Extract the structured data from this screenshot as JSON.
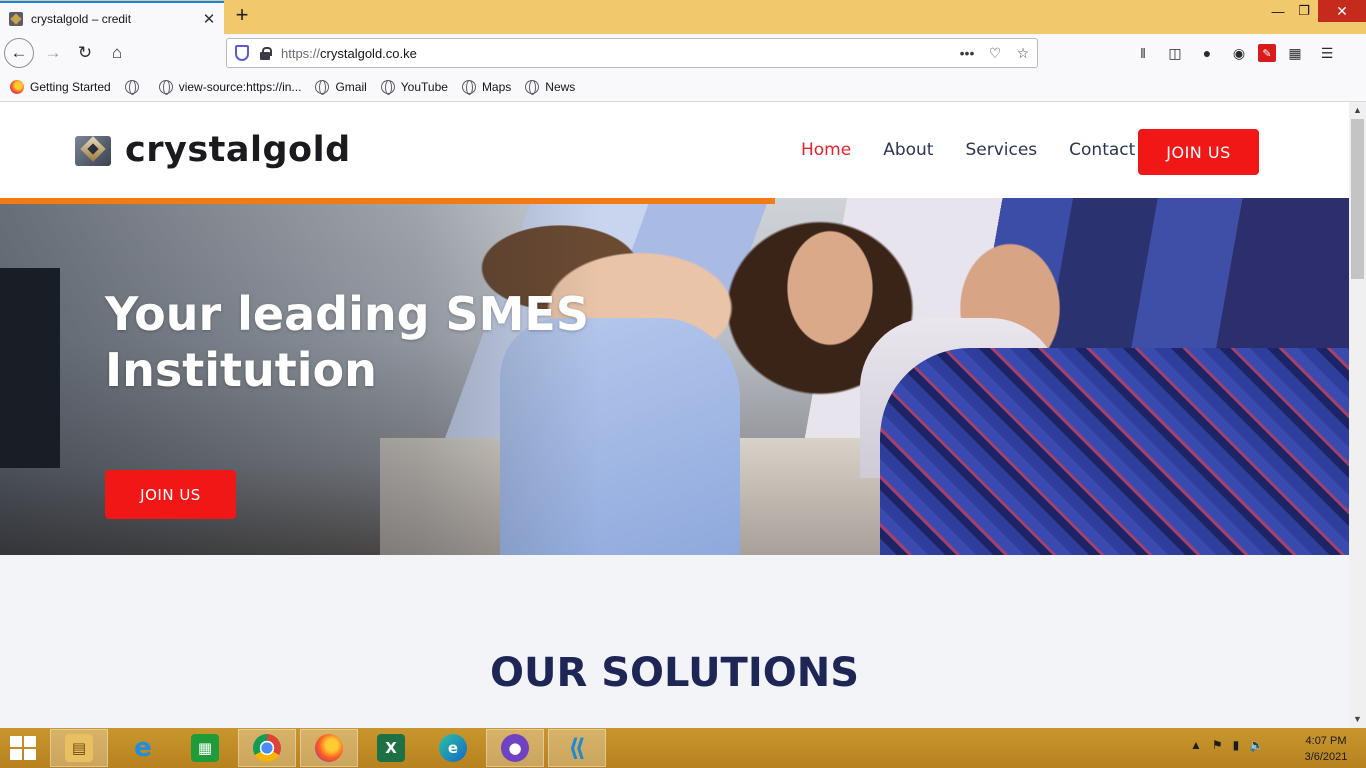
{
  "browser": {
    "tab_title": "crystalgold – credit",
    "tab_close": "✕",
    "new_tab": "+",
    "url_protocol": "https://",
    "url_host": "crystalgold.co.ke",
    "page_actions": "•••",
    "bookmarks": [
      "Getting Started",
      "",
      "view-source:https://in...",
      "Gmail",
      "YouTube",
      "Maps",
      "News"
    ]
  },
  "site": {
    "logo_text": "crystalgold",
    "nav": [
      "Home",
      "About",
      "Services",
      "Contact"
    ],
    "header_cta": "JOIN US",
    "hero_line1": "Your leading SMES",
    "hero_line2": "Institution",
    "hero_cta": "JOIN US",
    "section_title": "OUR SOLUTIONS",
    "accent": "#f21717",
    "nav_active": "#e8222a",
    "heading_navy": "#1e2656",
    "stripe_orange": "#f47b13"
  },
  "taskbar": {
    "apps": [
      "internet-explorer-icon",
      "file-explorer-icon",
      "store-icon",
      "chrome-icon",
      "firefox-icon",
      "excel-icon",
      "edge-icon",
      "github-desktop-icon",
      "vscode-icon"
    ],
    "time": "4:07 PM",
    "date": "3/6/2021"
  }
}
